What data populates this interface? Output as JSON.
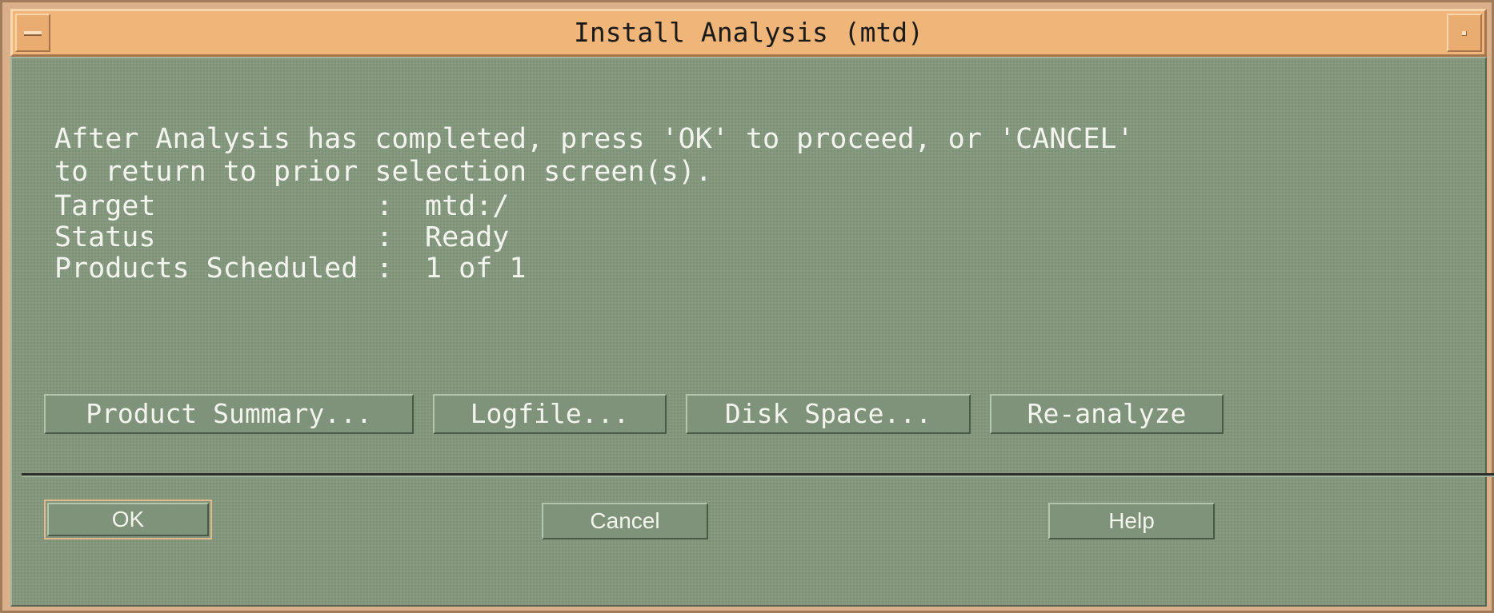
{
  "window": {
    "title": "Install Analysis (mtd)"
  },
  "instruction": {
    "line1": "After Analysis has completed, press 'OK' to proceed, or 'CANCEL'",
    "line2": "to return to prior selection screen(s)."
  },
  "info": {
    "target": {
      "label": "Target",
      "separator": ":",
      "value": "mtd:/"
    },
    "status": {
      "label": "Status",
      "separator": ":",
      "value": "Ready"
    },
    "products": {
      "label": "Products Scheduled",
      "separator": ":",
      "value": "1 of 1"
    }
  },
  "actions": {
    "product_summary": "Product Summary...",
    "logfile": "Logfile...",
    "disk_space": "Disk Space...",
    "reanalyze": "Re-analyze"
  },
  "dialog_buttons": {
    "ok": "OK",
    "cancel": "Cancel",
    "help": "Help"
  },
  "colors": {
    "title_bar": "#f0b578",
    "dialog_background": "#83977d",
    "text": "#f4f4ee"
  },
  "icons": {
    "window_menu": "window-menu-icon",
    "maximize": "maximize-icon"
  }
}
